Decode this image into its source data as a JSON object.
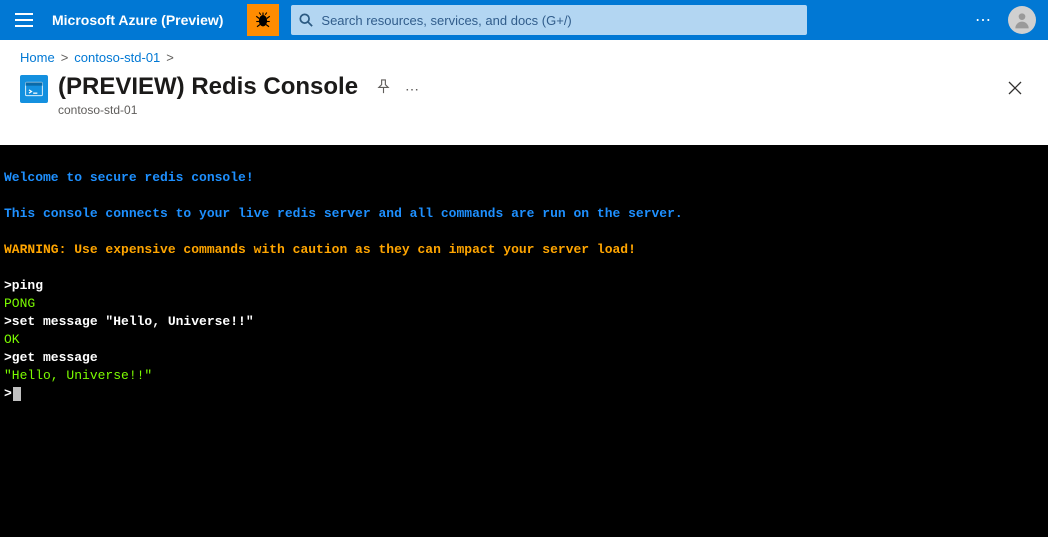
{
  "header": {
    "product": "Microsoft Azure (Preview)",
    "search_placeholder": "Search resources, services, and docs (G+/)"
  },
  "breadcrumb": {
    "home": "Home",
    "resource": "contoso-std-01"
  },
  "page": {
    "title": "(PREVIEW) Redis Console",
    "subtitle": "contoso-std-01"
  },
  "console": {
    "welcome": "Welcome to secure redis console!",
    "info": "This console connects to your live redis server and all commands are run on the server.",
    "warning": "WARNING: Use expensive commands with caution as they can impact your server load!",
    "lines": {
      "cmd1": ">ping",
      "out1": "PONG",
      "cmd2": ">set message \"Hello, Universe!!\"",
      "out2": "OK",
      "cmd3": ">get message",
      "out3": "\"Hello, Universe!!\"",
      "prompt": ">"
    }
  }
}
